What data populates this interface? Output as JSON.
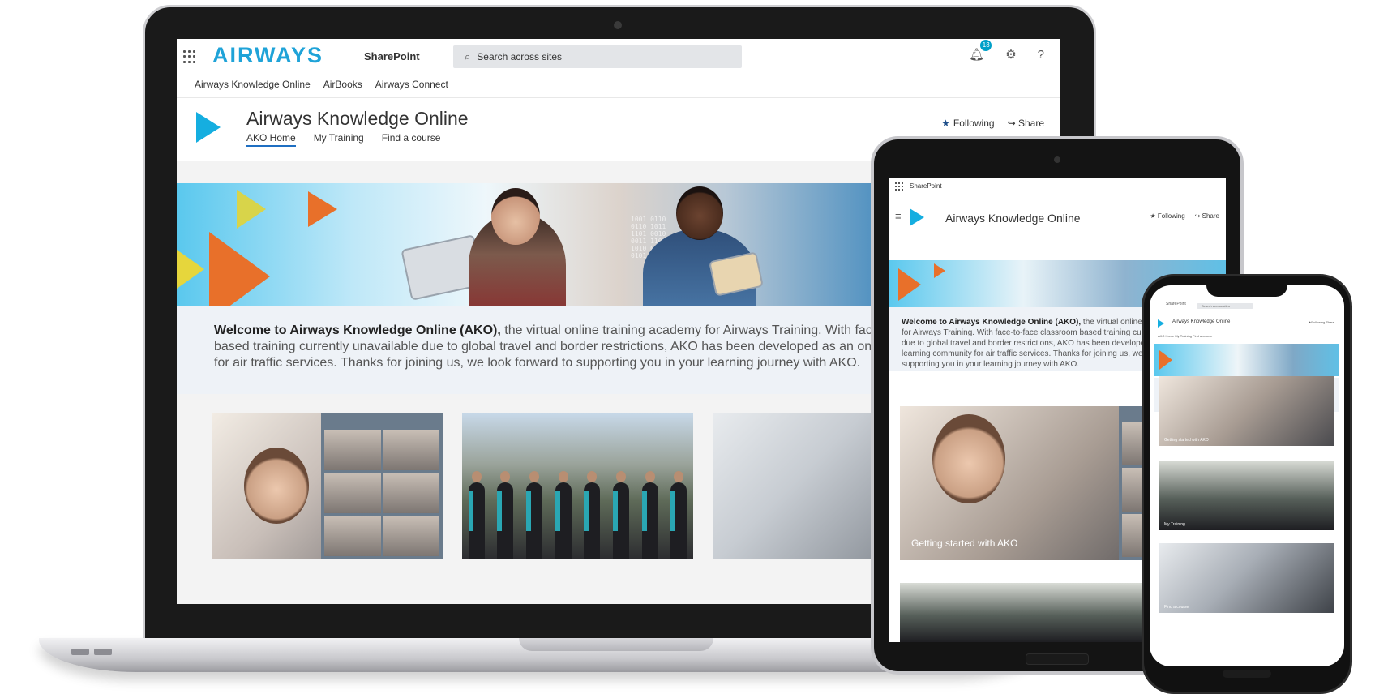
{
  "laptop": {
    "brand_logo": "AIRWAYS",
    "app_name": "SharePoint",
    "search_placeholder": "Search across sites",
    "notification_count": "13",
    "hub_nav": [
      "Airways Knowledge Online",
      "AirBooks",
      "Airways Connect"
    ],
    "site_title": "Airways Knowledge Online",
    "tabs": [
      "AKO Home",
      "My Training",
      "Find a course"
    ],
    "active_tab": "AKO Home",
    "follow_label": "Following",
    "share_label": "Share",
    "welcome_bold": "Welcome to Airways Knowledge Online (AKO),",
    "welcome_text": " the virtual online training academy for Airways Training. With face-to-face classroom based training currently unavailable due to global travel and border restrictions, AKO has been developed as an online learning community for air traffic services. Thanks for joining us, we look forward to supporting you in your learning journey with AKO."
  },
  "tablet": {
    "app_name": "SharePoint",
    "site_title": "Airways Knowledge Online",
    "follow_label": "Following",
    "share_label": "Share",
    "welcome_bold": "Welcome to Airways Knowledge Online (AKO),",
    "welcome_text": " the virtual online training academy for Airways Training. With face-to-face classroom based training currently unavailable due to global travel and border restrictions, AKO has been developed as an online learning community for air traffic services. Thanks for joining us, we look forward to supporting you in your learning journey with AKO.",
    "card_caption": "Getting started with AKO"
  },
  "phone": {
    "app_name": "SharePoint",
    "search_placeholder": "Search across sites",
    "site_title": "Airways Knowledge Online",
    "follow_label": "Following",
    "share_label": "Share",
    "tabs_line": "AKO Home   My Training   Find a course",
    "welcome_bold": "Welcome to Airways Knowledge Online (AKO),",
    "welcome_text": " the virtual online training academy for Airways Training. With face-to-face classroom based training currently unavailable due to global travel and border restrictions, AKO has been developed as an online learning community for air traffic services. Thanks for joining us, we look forward to supporting you in your learning journey with AKO.",
    "cards": [
      "Getting started with AKO",
      "My Training",
      "Find a course"
    ]
  },
  "colors": {
    "brand": "#1fa3d8",
    "accent_play": "#15aee0",
    "tab_underline": "#1f6fc2",
    "welcome_bg": "#eef2f7"
  }
}
